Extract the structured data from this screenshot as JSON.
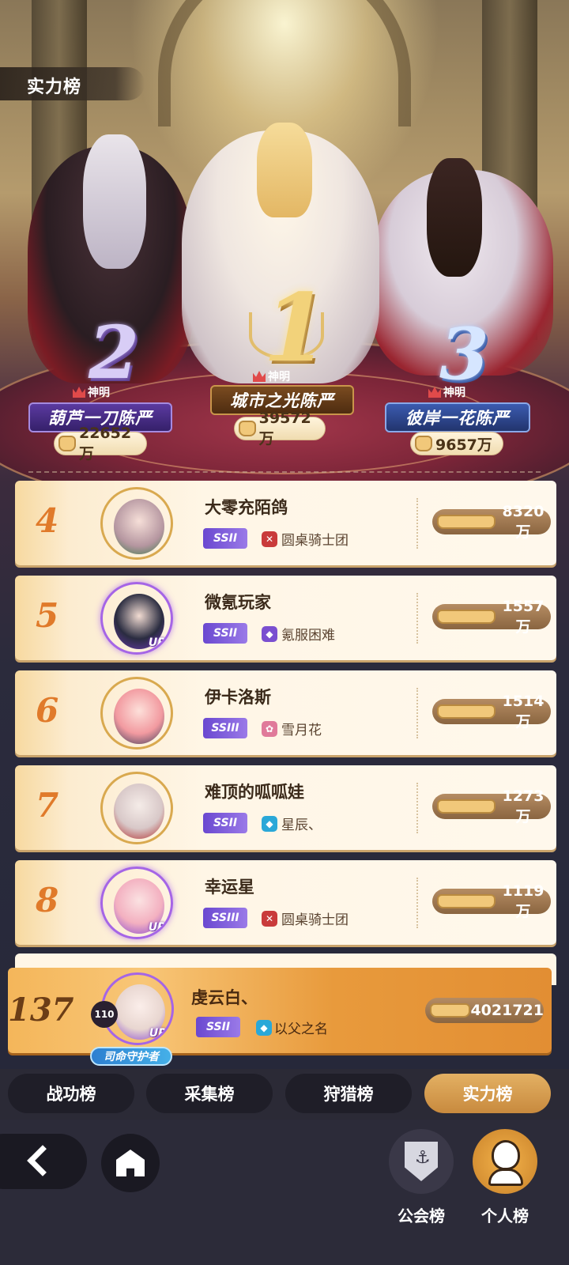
{
  "header": {
    "title": "实力榜"
  },
  "podium": [
    {
      "rank": "1",
      "title": "神明",
      "name": "城市之光陈严",
      "power": "39572万"
    },
    {
      "rank": "2",
      "title": "神明",
      "name": "葫芦一刀陈严",
      "power": "22652万"
    },
    {
      "rank": "3",
      "title": "神明",
      "name": "彼岸一花陈严",
      "power": "9657万"
    }
  ],
  "list": [
    {
      "rank": "4",
      "name": "大零充陌鸽",
      "tier": "SSII",
      "guild": "圆桌骑士团",
      "power": "8320万"
    },
    {
      "rank": "5",
      "name": "微氪玩家",
      "tier": "SSII",
      "guild": "氪服困难",
      "power": "1557万",
      "badge": "UR"
    },
    {
      "rank": "6",
      "name": "伊卡洛斯",
      "tier": "SSIII",
      "guild": "雪月花",
      "power": "1514万"
    },
    {
      "rank": "7",
      "name": "难顶的呱呱娃",
      "tier": "SSII",
      "guild": "星辰、",
      "power": "1273万"
    },
    {
      "rank": "8",
      "name": "幸运星",
      "tier": "SSIII",
      "guild": "圆桌骑士团",
      "power": "1119万",
      "badge": "UR"
    }
  ],
  "me": {
    "rank": "137",
    "level": "110",
    "name": "虔云白、",
    "tier": "SSII",
    "guild": "以父之名",
    "power": "4021721",
    "badge": "UR",
    "title": "司命守护者"
  },
  "tabs": [
    "战功榜",
    "采集榜",
    "狩猎榜",
    "实力榜"
  ],
  "active_tab": "实力榜",
  "bottom": {
    "guild_rank": "公会榜",
    "personal_rank": "个人榜"
  },
  "icons": {
    "back": "chevron-left-icon",
    "home": "home-icon",
    "guild": "anchor-shield-icon",
    "personal": "character-head-icon",
    "power": "fist-icon",
    "crown": "crown-icon"
  },
  "colors": {
    "accent": "#e3b063",
    "rank_number": "#e07a2a",
    "tier": "#6a48d0"
  }
}
